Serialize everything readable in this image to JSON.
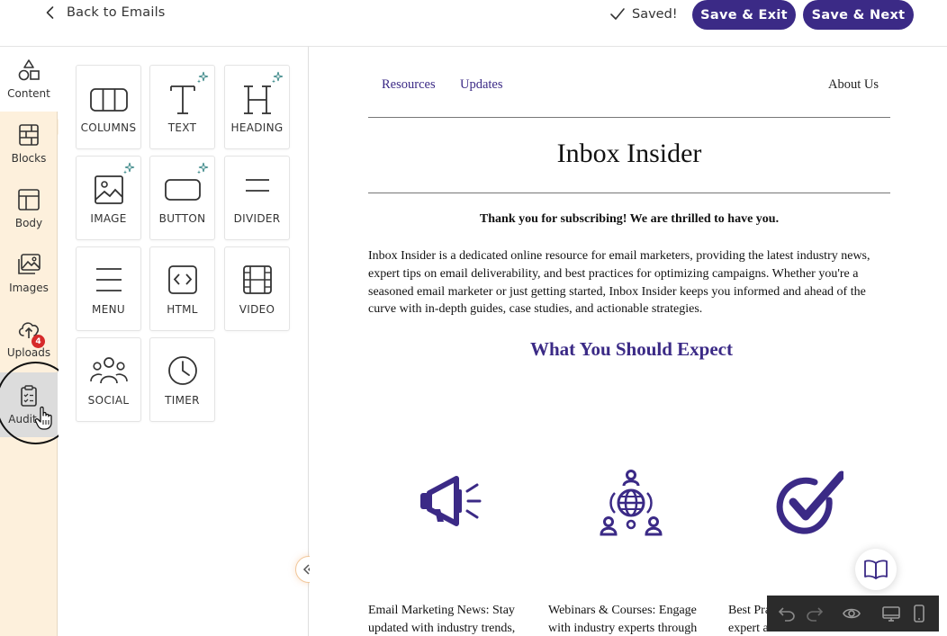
{
  "header": {
    "back_label": "Back to Emails",
    "saved_label": "Saved!",
    "save_exit_label": "Save & Exit",
    "save_next_label": "Save & Next"
  },
  "rail": {
    "items": [
      {
        "label": "Content",
        "icon": "shapes-icon"
      },
      {
        "label": "Blocks",
        "icon": "blocks-icon"
      },
      {
        "label": "Body",
        "icon": "layout-icon"
      },
      {
        "label": "Images",
        "icon": "images-icon"
      },
      {
        "label": "Uploads",
        "icon": "cloud-upload-icon"
      },
      {
        "label": "Audit",
        "icon": "clipboard-icon"
      }
    ],
    "audit_badge": "4"
  },
  "tools": [
    {
      "label": "COLUMNS",
      "icon": "columns-icon",
      "ai": false
    },
    {
      "label": "TEXT",
      "icon": "text-icon",
      "ai": true
    },
    {
      "label": "HEADING",
      "icon": "heading-icon",
      "ai": true
    },
    {
      "label": "IMAGE",
      "icon": "image-icon",
      "ai": true
    },
    {
      "label": "BUTTON",
      "icon": "button-icon",
      "ai": true
    },
    {
      "label": "DIVIDER",
      "icon": "divider-icon",
      "ai": false
    },
    {
      "label": "MENU",
      "icon": "menu-icon",
      "ai": false
    },
    {
      "label": "HTML",
      "icon": "html-icon",
      "ai": false
    },
    {
      "label": "VIDEO",
      "icon": "video-icon",
      "ai": false
    },
    {
      "label": "SOCIAL",
      "icon": "social-icon",
      "ai": false
    },
    {
      "label": "TIMER",
      "icon": "timer-icon",
      "ai": false
    }
  ],
  "email": {
    "nav": {
      "resources": "Resources",
      "updates": "Updates",
      "about": "About Us"
    },
    "title": "Inbox Insider",
    "thanks": "Thank you for subscribing! We are thrilled to have you.",
    "intro_lines": [
      "Inbox Insider is a dedicated online resource for email marketers, providing the latest industry news,",
      "expert tips on email deliverability, and best practices for optimizing campaigns. Whether you're a",
      "seasoned email marketer or just getting started, Inbox Insider keeps you informed and ahead of the",
      "curve with in-depth guides, case studies, and actionable strategies."
    ],
    "section_heading": "What You Should Expect",
    "features": [
      {
        "icon": "megaphone-icon",
        "line1": "Email Marketing News: Stay",
        "line2": "updated with industry trends,"
      },
      {
        "icon": "globe-network-icon",
        "line1": "Webinars & Courses: Engage",
        "line2": "with industry experts through"
      },
      {
        "icon": "checkmark-icon",
        "line1": "Best Pra",
        "line2": "expert a"
      }
    ]
  },
  "colors": {
    "brand": "#3b2a86",
    "rail_bg": "#fdf0dc",
    "badge": "#d62a2a",
    "toolbar_bg": "#2b2b2b"
  },
  "bottom_toolbar": {
    "icons": [
      "undo-icon",
      "redo-icon",
      "preview-eye-icon",
      "desktop-icon",
      "mobile-icon"
    ]
  }
}
